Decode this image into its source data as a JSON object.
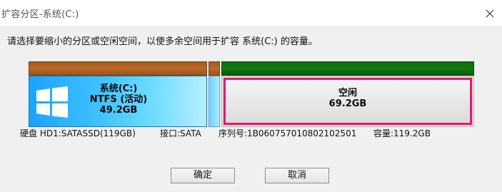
{
  "window": {
    "title": "扩容分区-系统(C:)"
  },
  "instruction": "请选择要缩小的分区或空闲空间，以使多余空间用于扩容 系统(C:) 的容量。",
  "partitions": [
    {
      "name": "系统(C:)",
      "fs": "NTFS (活动)",
      "size": "49.2GB"
    },
    {
      "name": "",
      "fs": "",
      "size": ""
    },
    {
      "name": "空闲",
      "fs": "",
      "size": "69.2GB"
    }
  ],
  "disk_info": {
    "disk": "硬盘 HD1:SATASSD(119GB)",
    "interface": "接口:SATA",
    "serial": "序列号:1B060757010802102501",
    "capacity": "容量:119.2GB"
  },
  "buttons": {
    "ok": "确定",
    "cancel": "取消"
  },
  "colors": {
    "system_partition": "#3fc2ff",
    "free_space_highlight": "#e8186e",
    "primary_bar": "#b8692a",
    "free_bar": "#157a15"
  }
}
